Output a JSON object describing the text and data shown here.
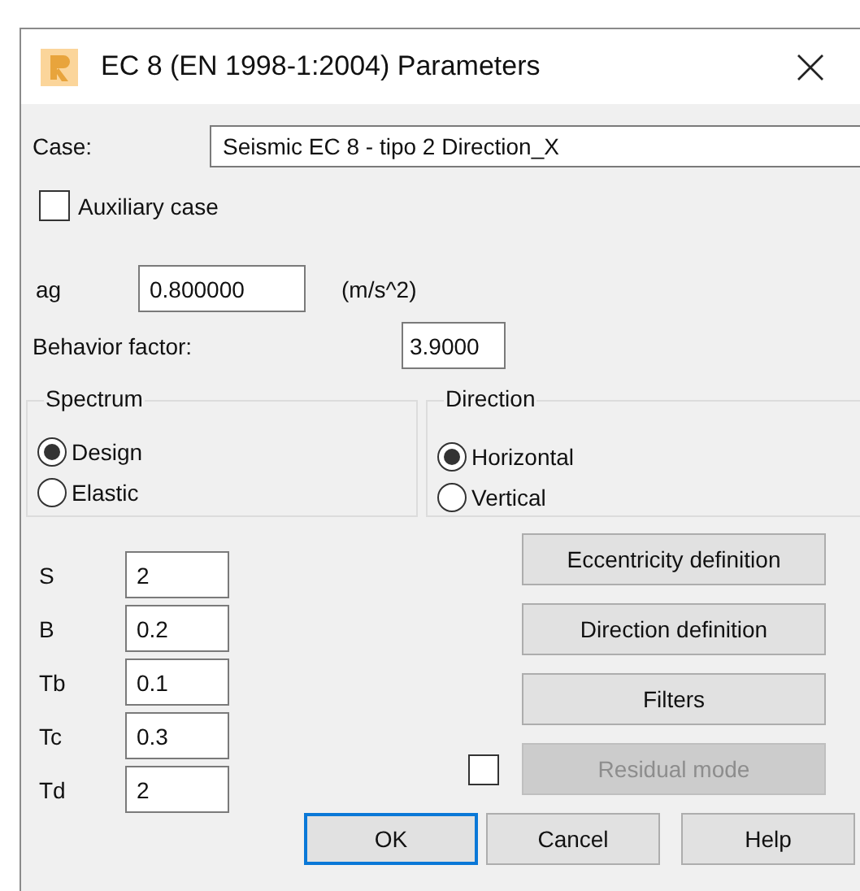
{
  "window": {
    "title": "EC 8 (EN 1998-1:2004) Parameters"
  },
  "case": {
    "label": "Case:",
    "value": "Seismic EC 8 - tipo 2 Direction_X"
  },
  "auxiliary_case": {
    "label": "Auxiliary case",
    "checked": false
  },
  "ag": {
    "label": "ag",
    "value": "0.800000",
    "unit": "(m/s^2)"
  },
  "behavior_factor": {
    "label": "Behavior factor:",
    "value": "3.9000"
  },
  "spectrum": {
    "title": "Spectrum",
    "options": [
      {
        "label": "Design",
        "selected": true
      },
      {
        "label": "Elastic",
        "selected": false
      }
    ]
  },
  "direction": {
    "title": "Direction",
    "options": [
      {
        "label": "Horizontal",
        "selected": true
      },
      {
        "label": "Vertical",
        "selected": false
      }
    ]
  },
  "parameters": [
    {
      "label": "S",
      "value": "2"
    },
    {
      "label": "B",
      "value": "0.2"
    },
    {
      "label": "Tb",
      "value": "0.1"
    },
    {
      "label": "Tc",
      "value": "0.3"
    },
    {
      "label": "Td",
      "value": "2"
    }
  ],
  "side_buttons": [
    {
      "label": "Eccentricity definition",
      "disabled": false
    },
    {
      "label": "Direction definition",
      "disabled": false
    },
    {
      "label": "Filters",
      "disabled": false
    },
    {
      "label": "Residual mode",
      "disabled": true,
      "checked": false
    }
  ],
  "buttons": [
    {
      "label": "OK",
      "default": true
    },
    {
      "label": "Cancel",
      "default": false
    },
    {
      "label": "Help",
      "default": false
    }
  ]
}
